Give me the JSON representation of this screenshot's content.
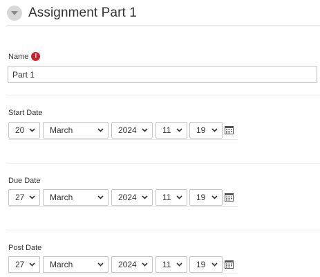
{
  "section": {
    "title": "Assignment Part 1"
  },
  "name_field": {
    "label": "Name",
    "value": "Part 1"
  },
  "dates": [
    {
      "label": "Start Date",
      "day": "20",
      "month": "March",
      "year": "2024",
      "hour": "11",
      "minute": "19"
    },
    {
      "label": "Due Date",
      "day": "27",
      "month": "March",
      "year": "2024",
      "hour": "11",
      "minute": "19"
    },
    {
      "label": "Post Date",
      "day": "27",
      "month": "March",
      "year": "2024",
      "hour": "11",
      "minute": "19"
    }
  ],
  "colors": {
    "required": "#c1272d",
    "collapse_button": "#d8d8d8",
    "text": "#333333"
  },
  "icons": {
    "collapse": "chevron-down-icon",
    "required": "exclamation-icon",
    "calendar": "calendar-icon"
  }
}
